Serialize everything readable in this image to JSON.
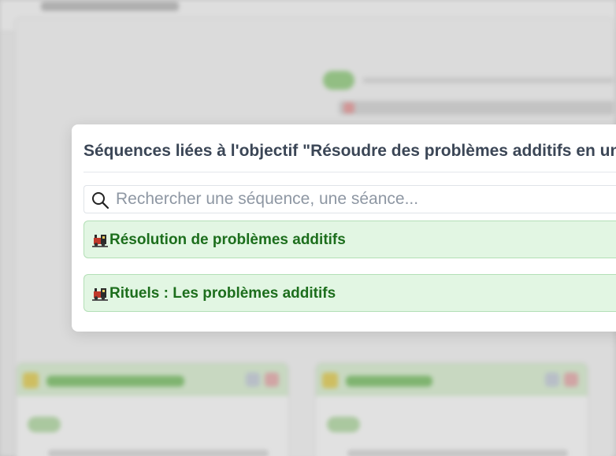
{
  "modal": {
    "title": "Séquences liées à l'objectif \"Résoudre des problèmes additifs en une é",
    "search": {
      "placeholder": "Rechercher une séquence, une séance...",
      "value": "",
      "icon": "search-icon"
    },
    "items": [
      {
        "icon": "train-icon",
        "label": "Résolution de problèmes additifs"
      },
      {
        "icon": "train-icon",
        "label": "Rituels : Les problèmes additifs"
      }
    ]
  },
  "colors": {
    "title": "#3b4656",
    "item_bg": "#e2f6e3",
    "item_border": "#b3dfb6",
    "item_text": "#1c6e1c",
    "placeholder": "#8e97a3"
  }
}
